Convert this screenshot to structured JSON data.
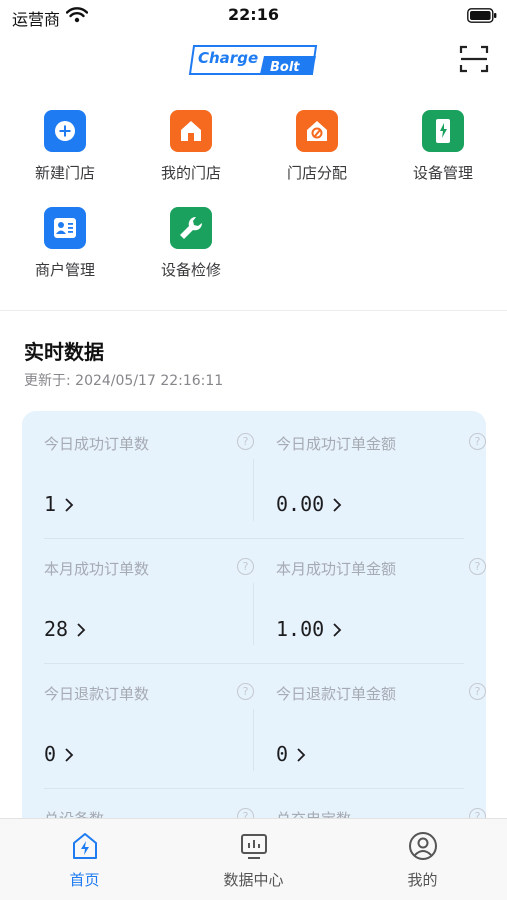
{
  "status_bar": {
    "carrier": "运营商",
    "time": "22:16"
  },
  "header": {
    "logo_text": "Charge Bolt",
    "logo_color": "#1e7bf2",
    "scan_icon": "scan-icon"
  },
  "quick_actions": [
    {
      "label": "新建门店",
      "icon": "add-store-icon",
      "color": "#1e7bf2"
    },
    {
      "label": "我的门店",
      "icon": "home-icon",
      "color": "#f56a1e"
    },
    {
      "label": "门店分配",
      "icon": "assign-store-icon",
      "color": "#f56a1e"
    },
    {
      "label": "设备管理",
      "icon": "device-icon",
      "color": "#1aa15e"
    },
    {
      "label": "商户管理",
      "icon": "merchant-icon",
      "color": "#1e7bf2"
    },
    {
      "label": "设备检修",
      "icon": "wrench-icon",
      "color": "#1aa15e"
    }
  ],
  "realtime": {
    "title": "实时数据",
    "updated_prefix": "更新于:",
    "updated_at": "2024/05/17 22:16:11",
    "stats": [
      {
        "label": "今日成功订单数",
        "value": "1"
      },
      {
        "label": "今日成功订单金额",
        "value": "0.00"
      },
      {
        "label": "本月成功订单数",
        "value": "28"
      },
      {
        "label": "本月成功订单金额",
        "value": "1.00"
      },
      {
        "label": "今日退款订单数",
        "value": "0"
      },
      {
        "label": "今日退款订单金额",
        "value": "0"
      },
      {
        "label": "总设备数",
        "value": ""
      },
      {
        "label": "总充电宝数",
        "value": ""
      }
    ]
  },
  "tab_bar": {
    "active_color": "#1e7bf2",
    "tabs": [
      {
        "label": "首页",
        "icon": "home-bolt-icon",
        "active": true
      },
      {
        "label": "数据中心",
        "icon": "chart-monitor-icon",
        "active": false
      },
      {
        "label": "我的",
        "icon": "profile-icon",
        "active": false
      }
    ]
  }
}
